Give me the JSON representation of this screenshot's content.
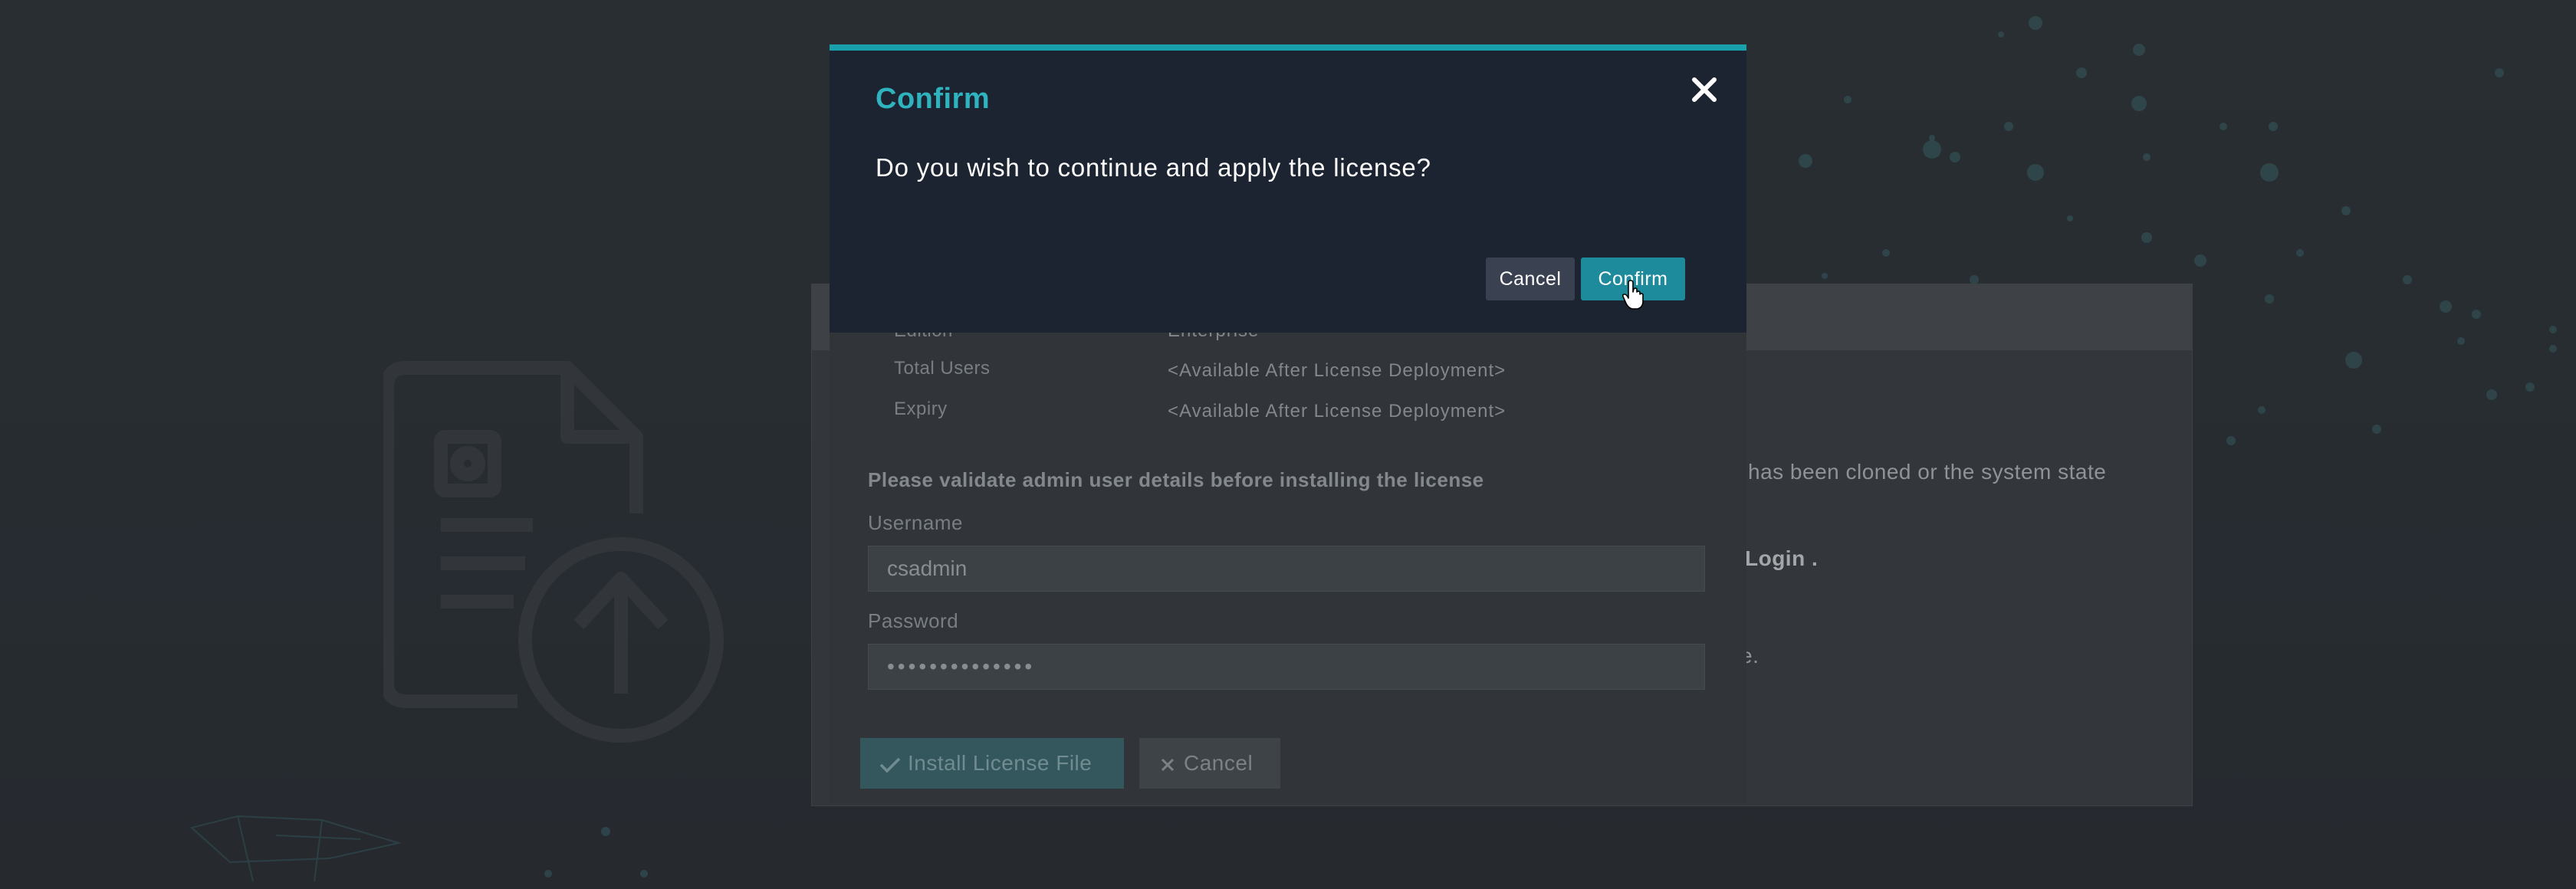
{
  "background": {
    "panel_text": {
      "line1": "has been cloned or the system state",
      "line2": "Login .",
      "line3": "e."
    },
    "license_info": [
      {
        "label": "Edition",
        "value": "Enterprise"
      },
      {
        "label": "Total Users",
        "value": "<Available After License Deployment>"
      },
      {
        "label": "Expiry",
        "value": "<Available After License Deployment>"
      }
    ],
    "hint": "Please validate admin user details before installing the license",
    "username": {
      "label": "Username",
      "value": "csadmin"
    },
    "password": {
      "label": "Password",
      "value": "••••••••••••••"
    },
    "install_button": "Install License File",
    "cancel_button": "Cancel",
    "icons": {
      "hero": "license-upload-icon",
      "check": "check-icon",
      "close": "close-icon"
    }
  },
  "modal": {
    "title": "Confirm",
    "message": "Do you wish to continue and apply the license?",
    "cancel_label": "Cancel",
    "confirm_label": "Confirm",
    "close_icon": "close-icon"
  },
  "colors": {
    "accent": "#1aa0aa",
    "modal_bg": "#1c2331",
    "confirm_bg": "#1d8b9b",
    "page_bg": "#2b3034"
  }
}
